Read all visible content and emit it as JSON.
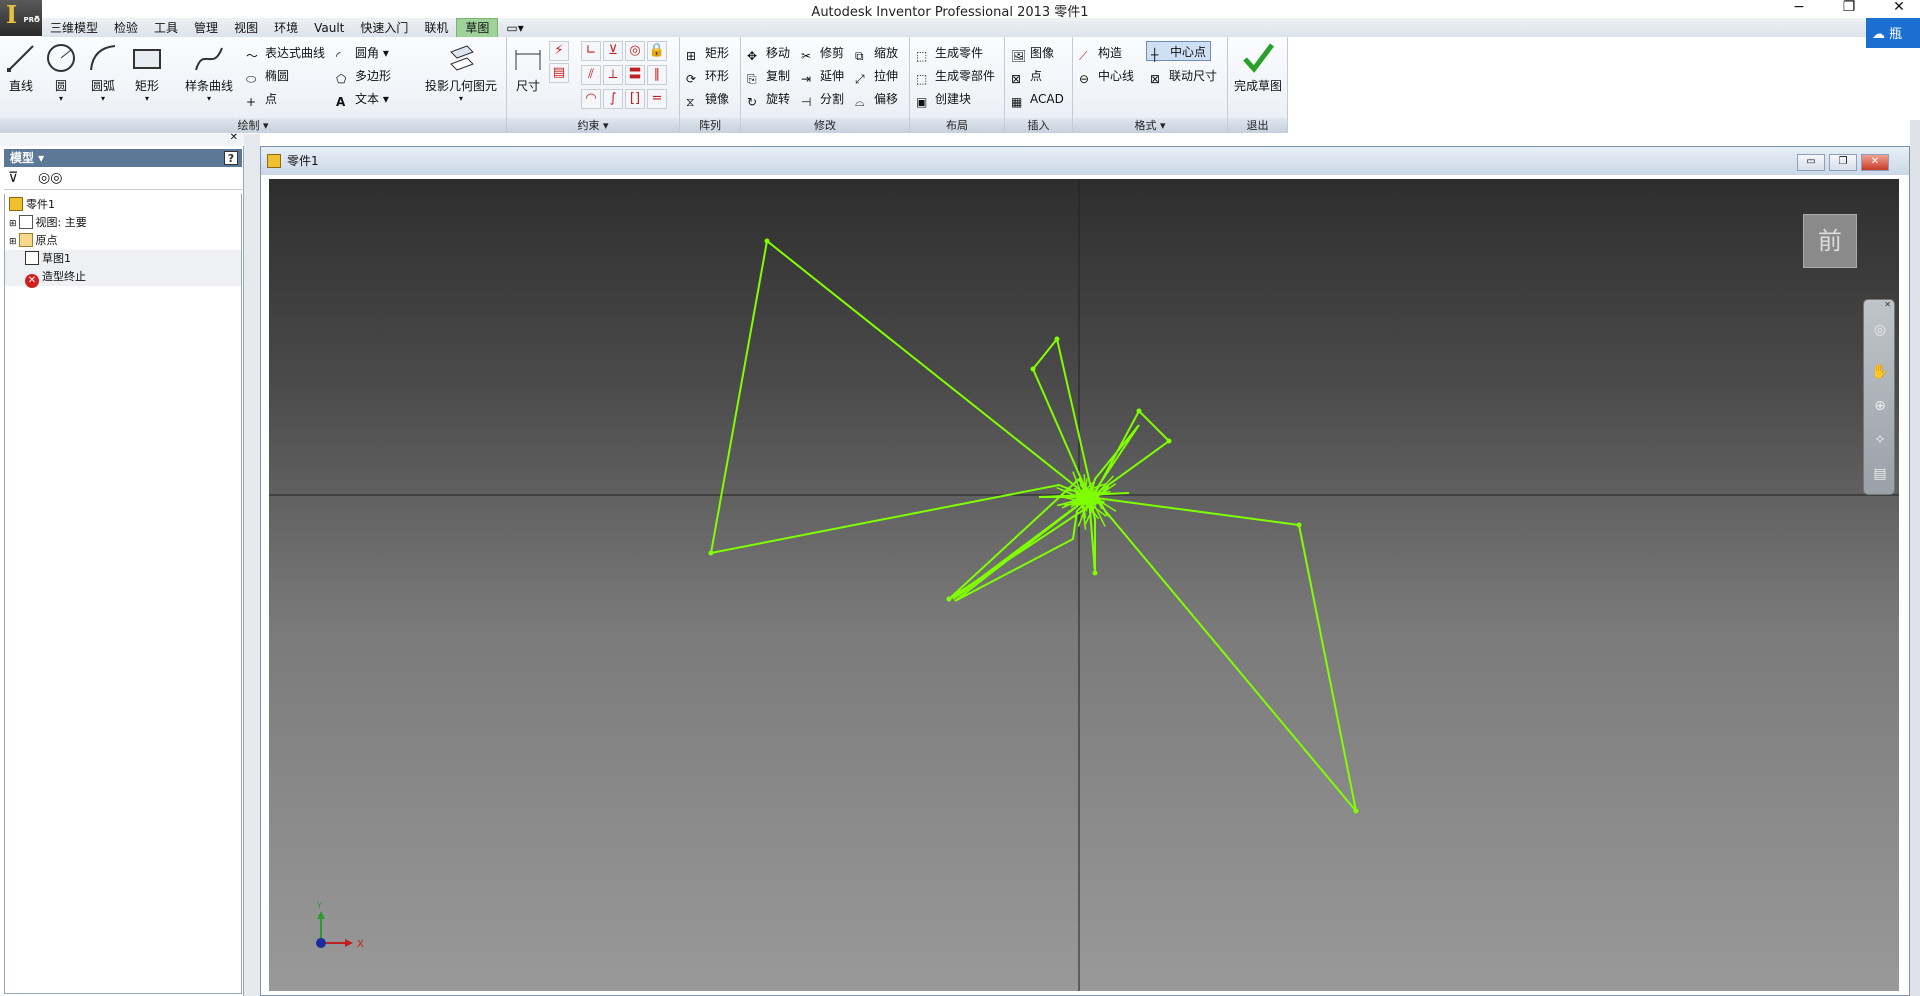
{
  "window": {
    "title": "Autodesk Inventor Professional 2013   零件1",
    "minimize": "−",
    "restore": "❐",
    "close": "✕"
  },
  "app_button": {
    "logo": "I",
    "edition": "PRO",
    "dropdown": "▾"
  },
  "menus": [
    "三维模型",
    "检验",
    "工具",
    "管理",
    "视图",
    "环境",
    "Vault",
    "快速入门",
    "联机",
    "草图",
    "▭▾"
  ],
  "active_menu_index": 9,
  "cloud_button": {
    "label": "瓶",
    "icon": "cloud-icon"
  },
  "ribbon": {
    "draw": {
      "label": "绘制 ▾",
      "big": [
        "直线",
        "圆",
        "圆弧",
        "矩形",
        "样条曲线"
      ],
      "small": [
        "表达式曲线",
        "椭圆",
        "点",
        "圆角",
        "多边形",
        "文本"
      ]
    },
    "project": {
      "label": "投影几何图元"
    },
    "constrain": {
      "label": "约束 ▾",
      "dimension": "尺寸"
    },
    "pattern": {
      "label": "阵列",
      "items": [
        "矩形",
        "环形",
        "镜像"
      ]
    },
    "modify": {
      "label": "修改",
      "items": [
        "移动",
        "修剪",
        "缩放",
        "复制",
        "延伸",
        "拉伸",
        "旋转",
        "分割",
        "偏移"
      ]
    },
    "layout": {
      "label": "布局",
      "items": [
        "生成零件",
        "生成零部件",
        "创建块"
      ]
    },
    "insert": {
      "label": "插入",
      "items": [
        "图像",
        "点",
        "ACAD"
      ]
    },
    "format": {
      "label": "格式 ▾",
      "items": [
        "构造",
        "中心点",
        "中心线",
        "联动尺寸"
      ]
    },
    "exit": {
      "label": "退出",
      "finish": "完成草图"
    }
  },
  "browser": {
    "header": "模型 ▾",
    "help": "?",
    "close": "✕",
    "tree": [
      {
        "label": "零件1",
        "icon": "part-icon"
      },
      {
        "label": "视图: 主要",
        "icon": "view-icon"
      },
      {
        "label": "原点",
        "icon": "folder-icon"
      },
      {
        "label": "草图1",
        "icon": "sketch-icon"
      },
      {
        "label": "造型终止",
        "icon": "end-of-part-icon"
      }
    ]
  },
  "document": {
    "title": "零件1"
  },
  "viewcube": {
    "label": "前"
  },
  "triad": {
    "x": "X",
    "y": "Y"
  },
  "colors": {
    "sketch": "#7fff00",
    "accent": "#9fd19a",
    "brand": "#1a6fd0"
  }
}
